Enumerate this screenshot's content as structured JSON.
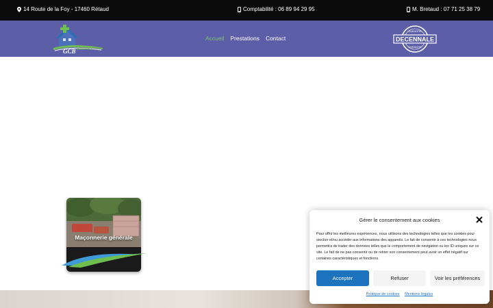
{
  "topbar": {
    "address": "14 Route de la Foy - 17460 Rétaud",
    "accounting": "Comptabilité : 06 89 94 29 95",
    "contact_person": "M. Bretaud : 07 71 25 38 79",
    "address_icon": "map-marker-icon",
    "phone_icon": "mobile-phone-icon"
  },
  "header": {
    "logo": {
      "mark": "GCB",
      "text": "Bâtiment"
    },
    "nav": [
      {
        "label": "Accueil",
        "active": true
      },
      {
        "label": "Prestations",
        "active": false
      },
      {
        "label": "Contact",
        "active": false
      }
    ],
    "badge": {
      "top": "GARANTIE",
      "main": "DECENNALE",
      "bottom": "GARANTIE"
    }
  },
  "card": {
    "title": "Maçonnerie générale"
  },
  "cookie": {
    "title": "Gérer le consentement aux cookies",
    "text": "Pour offrir les meilleures expériences, nous utilisons des technologies telles que les cookies pour stocker et/ou accéder aux informations des appareils. Le fait de consentir à ces technologies nous permettra de traiter des données telles que le comportement de navigation ou les ID uniques sur ce site. Le fait de ne pas consentir ou de retirer son consentement peut avoir un effet négatif sur certaines caractéristiques et fonctions.",
    "accept": "Accepter",
    "refuse": "Refuser",
    "preferences": "Voir les préférences",
    "links": [
      "Politique de cookies",
      "Mentions légales"
    ]
  },
  "colors": {
    "topbar": "#0b0b0b",
    "header": "#5c5ea8",
    "nav_active": "#7cc36b",
    "accept": "#1e73be"
  }
}
